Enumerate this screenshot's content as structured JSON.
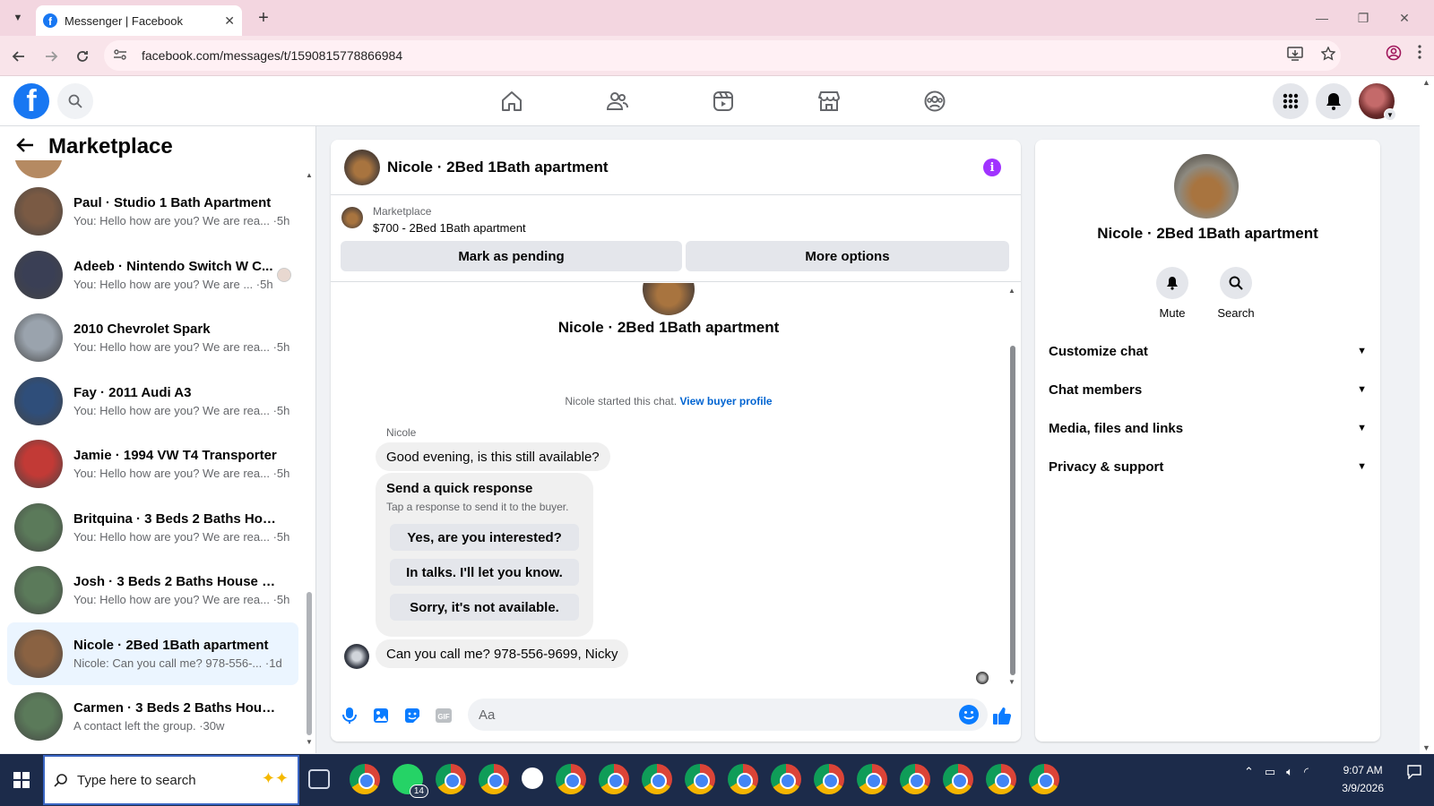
{
  "browser": {
    "tab_title": "Messenger | Facebook",
    "url": "facebook.com/messages/t/1590815778866984",
    "tab_close": "✕",
    "new_tab": "+",
    "minimize": "—",
    "restore": "❐",
    "close": "✕"
  },
  "sidebar": {
    "title": "Marketplace",
    "conversations": [
      {
        "name": "Paul · Studio 1 Bath Apartment",
        "preview": "You: Hello how are you? We are rea... ·5h",
        "thumb": "#7a5a44"
      },
      {
        "name": "Adeeb · Nintendo Switch W C...",
        "preview": "You: Hello how are you? We are ... ·5h",
        "thumb": "#3a3f55"
      },
      {
        "name": "2010 Chevrolet Spark",
        "preview": "You: Hello how are you? We are rea... ·5h",
        "thumb": "#9aa3ad"
      },
      {
        "name": "Fay · 2011 Audi A3",
        "preview": "You: Hello how are you? We are rea... ·5h",
        "thumb": "#2f4e7a"
      },
      {
        "name": "Jamie · 1994 VW T4 Transporter",
        "preview": "You: Hello how are you? We are rea... ·5h",
        "thumb": "#c23a36"
      },
      {
        "name": "Britquina · 3 Beds 2 Baths House...",
        "preview": "You: Hello how are you? We are rea... ·5h",
        "thumb": "#5b7a5a"
      },
      {
        "name": "Josh · 3 Beds 2 Baths House For ...",
        "preview": "You: Hello how are you? We are rea... ·5h",
        "thumb": "#5b7a5a"
      },
      {
        "name": "Nicole · 2Bed 1Bath apartment",
        "preview": "Nicole: Can you call me? 978-556-... ·1d",
        "thumb": "#8a6242"
      },
      {
        "name": "Carmen · 3 Beds 2 Baths House ...",
        "preview": "A contact left the group. ·30w",
        "thumb": "#5b7a5a"
      }
    ]
  },
  "chat": {
    "title": "Nicole · 2Bed 1Bath apartment",
    "marketplace_label": "Marketplace",
    "listing": "$700 - 2Bed 1Bath apartment",
    "mark_pending": "Mark as pending",
    "more_options": "More options",
    "hero_title": "Nicole · 2Bed 1Bath apartment",
    "started_text": "Nicole started this chat.",
    "view_profile": "View buyer profile",
    "sender": "Nicole",
    "msg1": "Good evening, is this still available?",
    "quick_title": "Send a quick response",
    "quick_sub": "Tap a response to send it to the buyer.",
    "quick_responses": [
      "Yes, are you interested?",
      "In talks. I'll let you know.",
      "Sorry, it's not available."
    ],
    "msg2": "Can you call me?  978-556-9699, Nicky",
    "composer_placeholder": "Aa",
    "info_icon": "i"
  },
  "right_panel": {
    "title": "Nicole · 2Bed 1Bath apartment",
    "mute": "Mute",
    "search": "Search",
    "sections": [
      "Customize chat",
      "Chat members",
      "Media, files and links",
      "Privacy & support"
    ]
  },
  "taskbar": {
    "search_placeholder": "Type here to search",
    "whatsapp_badge": "14",
    "time": "9:07 AM",
    "date": "3/9/2026"
  },
  "colors": {
    "facebook_blue": "#1877f2",
    "messenger_accent": "#0a7cff",
    "info_purple": "#a033ff",
    "active_row": "#ebf5ff"
  }
}
